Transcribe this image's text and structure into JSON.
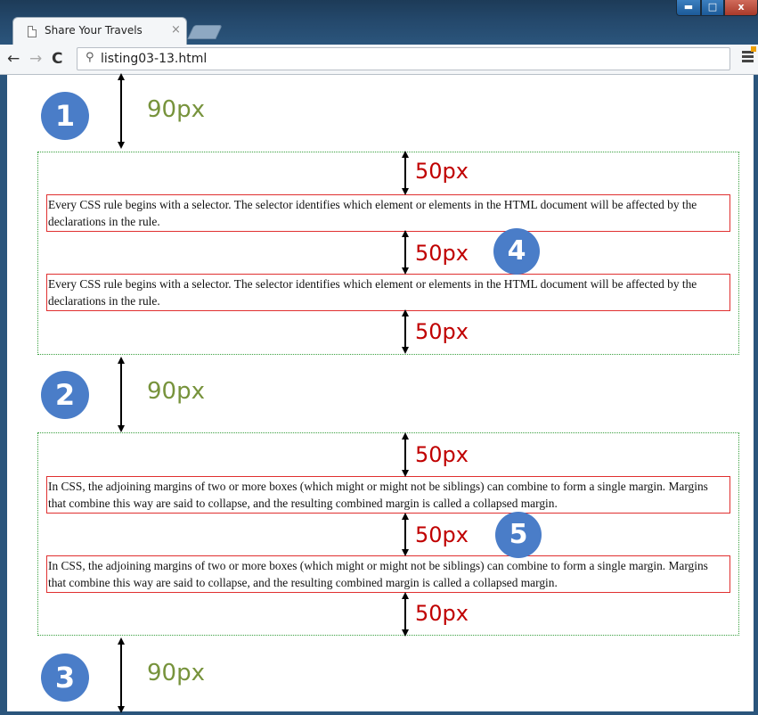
{
  "browser": {
    "tab_title": "Share Your Travels",
    "tab_close": "×",
    "url": "listing03-13.html",
    "back_glyph": "←",
    "forward_glyph": "→",
    "reload_glyph": "C",
    "search_glyph": "⚲",
    "window_min": "▬",
    "window_max": "□",
    "window_close": "x"
  },
  "page": {
    "paragraph_1": "Every CSS rule begins with a selector. The selector identifies which element or elements in the HTML document will be affected by the declarations in the rule.",
    "paragraph_2": "In CSS, the adjoining margins of two or more boxes (which might or might not be siblings) can combine to form a single margin. Margins that combine this way are said to collapse, and the resulting combined margin is called a collapsed margin."
  },
  "annotations": {
    "outer_margin_label": "90px",
    "inner_margin_label": "50px",
    "marker_1": "1",
    "marker_2": "2",
    "marker_3": "3",
    "marker_4": "4",
    "marker_5": "5",
    "colors": {
      "marker_fill": "#4a7dc8",
      "outer_label": "#77933c",
      "inner_label": "#c00000",
      "container_border": "#3aa040",
      "paragraph_border": "#e03030"
    }
  },
  "icons": [
    "page-icon",
    "back-arrow-icon",
    "forward-arrow-icon",
    "reload-icon",
    "search-icon",
    "menu-icon"
  ]
}
